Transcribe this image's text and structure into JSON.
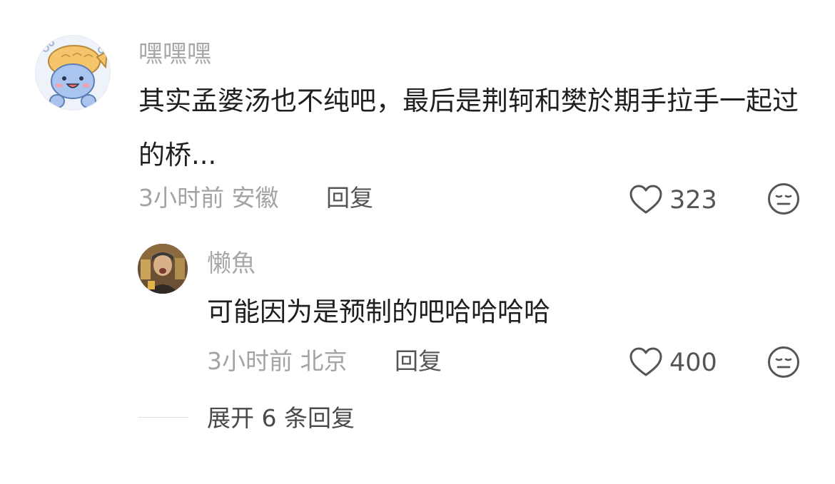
{
  "comment": {
    "username": "嘿嘿嘿",
    "avatar": "cartoon-whale-avatar",
    "text": "其实孟婆汤也不纯吧，最后是荆轲和樊於期手拉手一起过的桥...",
    "time": "3小时前",
    "location": "安徽",
    "reply_label": "回复",
    "like_count": "323",
    "like_icon": "heart-outline-icon",
    "dislike_icon": "meh-face-icon"
  },
  "reply": {
    "username": "懒魚",
    "avatar": "photo-avatar",
    "text": "可能因为是预制的吧哈哈哈哈",
    "time": "3小时前",
    "location": "北京",
    "reply_label": "回复",
    "like_count": "400",
    "like_icon": "heart-outline-icon",
    "dislike_icon": "meh-face-icon"
  },
  "expand": {
    "label": "展开 6 条回复"
  },
  "colors": {
    "name": "#a8a8a8",
    "text": "#1f1f1f",
    "meta": "#a3a3a3",
    "action": "#555555"
  }
}
